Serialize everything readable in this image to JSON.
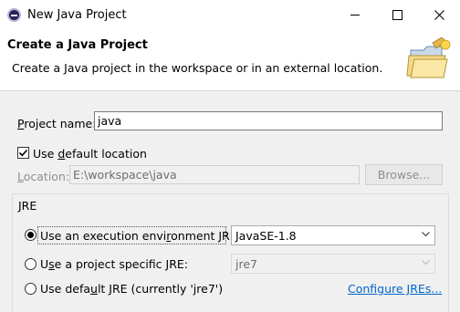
{
  "window": {
    "title": "New Java Project"
  },
  "header": {
    "title": "Create a Java Project",
    "description": "Create a Java project in the workspace or in an external location."
  },
  "project_name": {
    "label_prefix": "P",
    "label_rest": "roject name:",
    "value": "java"
  },
  "default_location": {
    "label_prefix": "Use ",
    "label_mnemonic": "d",
    "label_rest": "efault location",
    "checked": true
  },
  "location": {
    "label_prefix": "L",
    "label_rest": "ocation:",
    "value": "E:\\workspace\\java"
  },
  "browse_button": {
    "label": "Browse..."
  },
  "jre_group": {
    "label": "JRE",
    "option1": {
      "label_prefix": "Use an execution envi",
      "label_mnemonic": "r",
      "label_rest": "onment JRE:",
      "selected": true,
      "combo_value": "JavaSE-1.8"
    },
    "option2": {
      "label_prefix": "U",
      "label_mnemonic": "s",
      "label_rest": "e a project specific JRE:",
      "selected": false,
      "combo_value": "jre7"
    },
    "option3": {
      "label_prefix": "Use defa",
      "label_mnemonic": "u",
      "label_rest": "lt JRE (currently 'jre7')",
      "selected": false
    },
    "configure_link": "Configure JREs..."
  },
  "colors": {
    "link": "#0066cc",
    "disabled_text": "#8f8f8f",
    "header_bg": "#ffffff",
    "body_bg": "#f0f0f0"
  },
  "icons": [
    "app-icon",
    "folder-wizard-icon",
    "checkmark-icon",
    "chevron-down-icon"
  ]
}
